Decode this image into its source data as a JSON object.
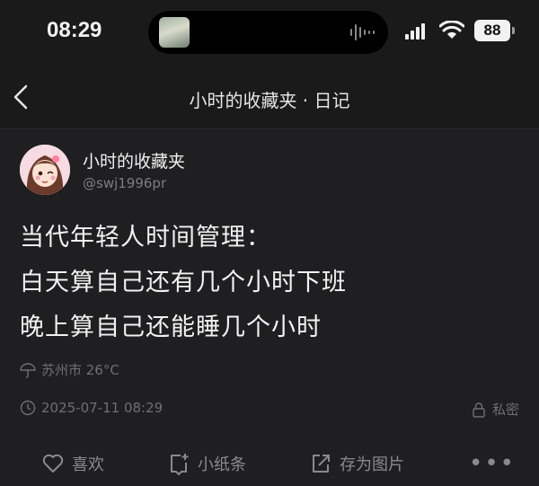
{
  "status_bar": {
    "time": "08:29",
    "battery": "88",
    "icons": [
      "signal-icon",
      "wifi-icon",
      "battery-icon",
      "audio-wave-icon"
    ]
  },
  "nav": {
    "title": "小时的收藏夹 · 日记",
    "back_icon": "chevron-left-icon"
  },
  "post": {
    "username": "小时的收藏夹",
    "handle": "@swj1996pr",
    "content": [
      "当代年轻人时间管理：",
      "白天算自己还有几个小时下班",
      "晚上算自己还能睡几个小时"
    ],
    "location": "苏州市 26°C",
    "datetime": "2025-07-11 08:29",
    "privacy": "私密"
  },
  "actions": {
    "like": "喜欢",
    "note": "小纸条",
    "save_image": "存为图片",
    "more": "•••"
  },
  "colors": {
    "background": "#1f1f21",
    "text": "#f2f2f2",
    "muted": "#6f6f73"
  }
}
